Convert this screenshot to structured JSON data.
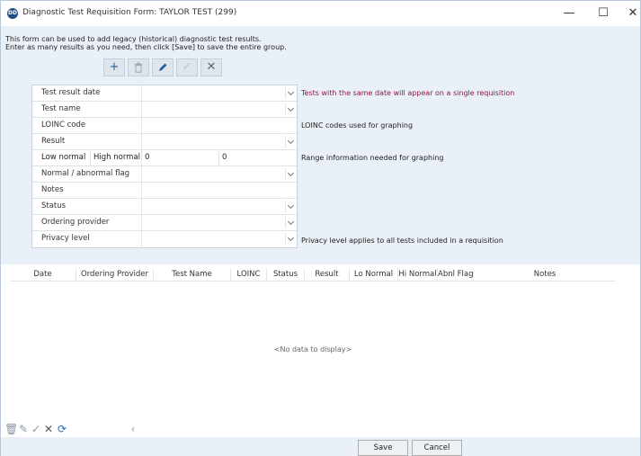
{
  "window": {
    "icon_text": "DD",
    "title": "Diagnostic Test Requisition Form: TAYLOR TEST (299)",
    "minimize": "—",
    "maximize": "☐",
    "close": "✕"
  },
  "intro": {
    "line1": "This form can be used to add legacy (historical) diagnostic test results.",
    "line2": "Enter as many results as you need, then click [Save] to save the entire group."
  },
  "toolbar": {
    "add": "+",
    "delete": "🗑",
    "edit": "✎",
    "accept": "✓",
    "cancel": "✕"
  },
  "form": {
    "test_result_date": {
      "label": "Test result date",
      "value": ""
    },
    "test_name": {
      "label": "Test name",
      "value": ""
    },
    "loinc_code": {
      "label": "LOINC code",
      "value": ""
    },
    "result": {
      "label": "Result",
      "value": ""
    },
    "low_normal": {
      "label": "Low normal",
      "value": "0"
    },
    "high_normal": {
      "label": "High normal",
      "value": "0"
    },
    "flag": {
      "label": "Normal / abnormal flag",
      "value": ""
    },
    "notes": {
      "label": "Notes",
      "value": ""
    },
    "status": {
      "label": "Status",
      "value": ""
    },
    "ordering_provider": {
      "label": "Ordering provider",
      "value": ""
    },
    "privacy_level": {
      "label": "Privacy level",
      "value": ""
    }
  },
  "notes": {
    "date": "Tests with the same date will appear on a single requisition",
    "loinc": "LOINC codes used for graphing",
    "range": "Range information needed for graphing",
    "privacy": "Privacy level applies to all tests included in a requisition"
  },
  "colors": {
    "date_note": "#8b1a3a"
  },
  "grid": {
    "columns": [
      "Date",
      "Ordering Provider",
      "Test Name",
      "LOINC",
      "Status",
      "Result",
      "Lo Normal",
      "Hi Normal",
      "Abnl Flag",
      "Notes"
    ],
    "empty_text": "<No data to display>"
  },
  "navigator": {
    "delete": "🗑",
    "edit": "✎",
    "accept": "✓",
    "cancel": "✕",
    "refresh": "⟳",
    "prev": "‹"
  },
  "buttons": {
    "save": "Save",
    "cancel": "Cancel"
  }
}
